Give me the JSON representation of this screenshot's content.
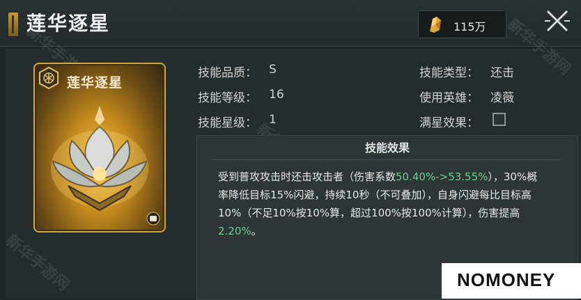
{
  "header": {
    "title": "莲华逐星",
    "currency_value": "115万",
    "close_icon": "close-icon"
  },
  "card": {
    "title": "莲华逐星",
    "badge_icon": "skill-badge-icon",
    "art_icon": "golden-lotus-icon",
    "corner_icon": "fist-icon"
  },
  "info": {
    "quality_label": "技能品质：",
    "quality_value": "S",
    "level_label": "技能等级：",
    "level_value": "16",
    "star_label": "技能星级：",
    "star_value": "1",
    "type_label": "技能类型：",
    "type_value": "还击",
    "hero_label": "使用英雄：",
    "hero_value": "凌薇",
    "full_star_label": "满星效果："
  },
  "effect": {
    "title": "技能效果",
    "part1": "受到普攻攻击时还击攻击者（伤害系数",
    "hl1": "50.40%->53.55%",
    "part2": "），30%概率降低目标15%闪避，持续10秒（不可叠加），自身闪避每比目标高10%（不足10%按10%算，超过100%按100%计算），伤害提高",
    "hl2": "2.20%",
    "part3": "。"
  },
  "watermark": "新华手游网",
  "logo": "NOMONEY",
  "colors": {
    "highlight": "#6fcf8e",
    "gold": "#d4a640",
    "background": "#1f2527"
  }
}
